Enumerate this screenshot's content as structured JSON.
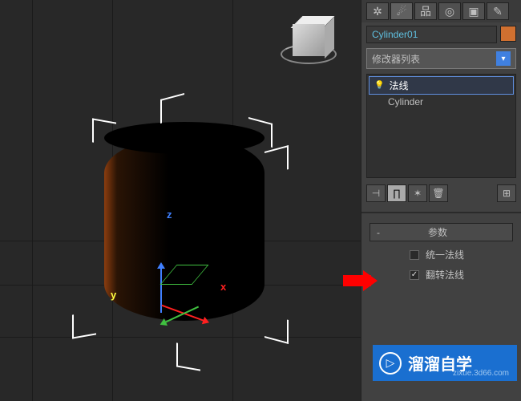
{
  "object": {
    "name": "Cylinder01"
  },
  "modifier_panel": {
    "dropdown_label": "修改器列表",
    "stack": [
      {
        "label": "法线",
        "active": true,
        "has_bulb": true
      },
      {
        "label": "Cylinder",
        "active": false,
        "has_bulb": false
      }
    ]
  },
  "rollout": {
    "title": "参数",
    "options": [
      {
        "label": "统一法线",
        "checked": false
      },
      {
        "label": "翻转法线",
        "checked": true
      }
    ]
  },
  "axis_labels": {
    "x": "x",
    "y": "y",
    "z": "z"
  },
  "watermark": {
    "title": "溜溜自学",
    "url": "zixue.3d66.com"
  }
}
